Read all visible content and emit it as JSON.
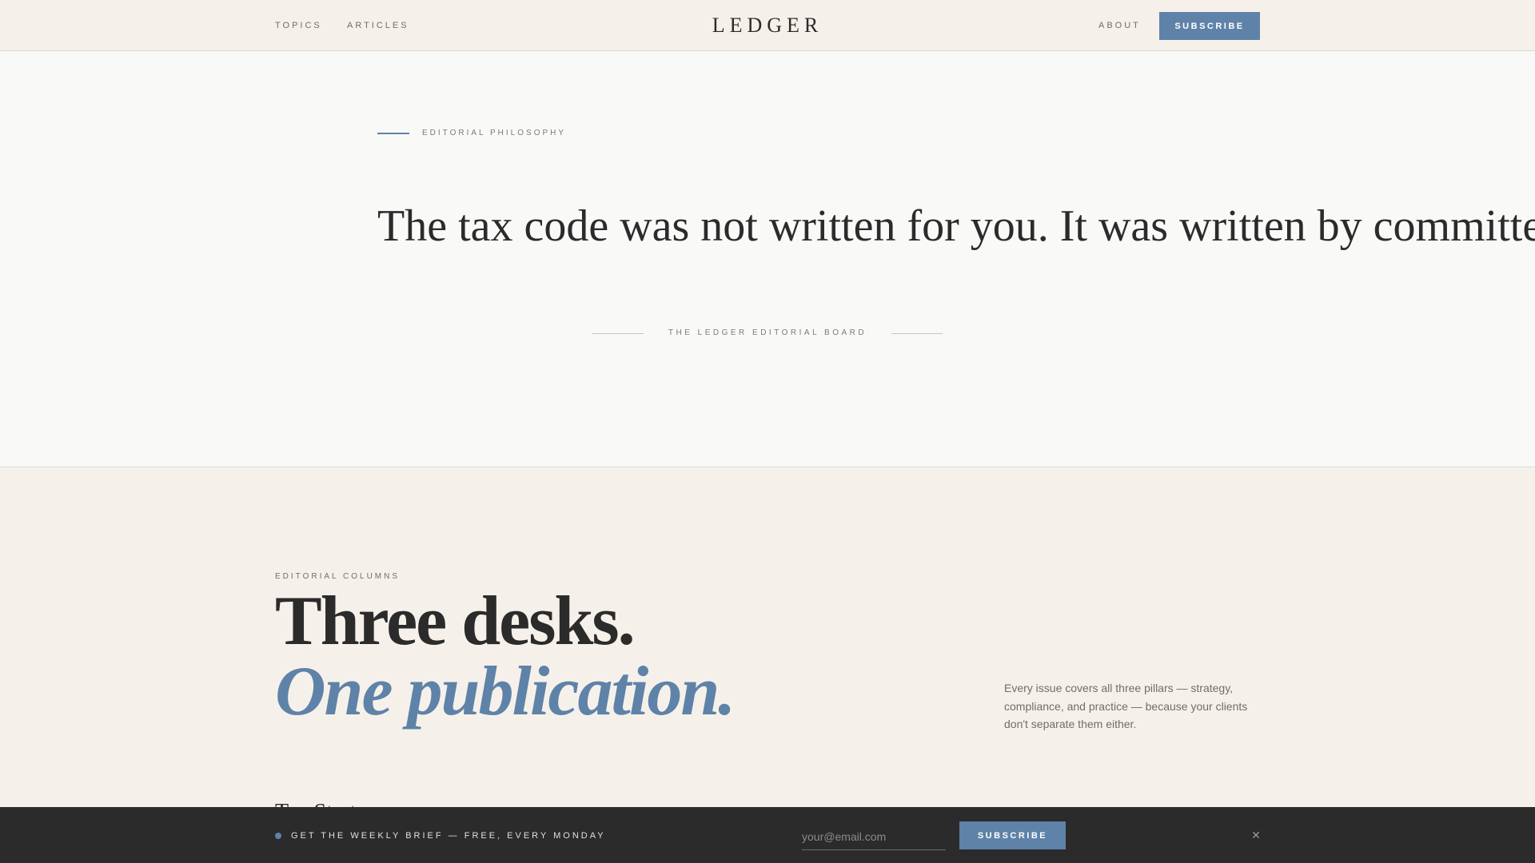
{
  "header": {
    "nav_left": [
      "TOPICS",
      "ARTICLES"
    ],
    "logo": "LEDGER",
    "nav_right": "ABOUT",
    "subscribe_label": "SUBSCRIBE"
  },
  "philosophy": {
    "eyebrow": "EDITORIAL PHILOSOPHY",
    "quote": "The tax code was not written for you. It was written by committees",
    "byline": "THE LEDGER EDITORIAL BOARD"
  },
  "columns": {
    "eyebrow": "EDITORIAL COLUMNS",
    "headline": "Three desks.",
    "headline_italic": "One publication.",
    "description": "Every issue covers all three pillars — strategy, compliance, and practice — because your clients don't separate them either.",
    "first_desk_title": "Tax Strategy"
  },
  "newsletter": {
    "text": "GET THE WEEKLY BRIEF — FREE, EVERY MONDAY",
    "email_placeholder": "your@email.com",
    "subscribe_label": "SUBSCRIBE",
    "close_icon": "close-icon"
  },
  "colors": {
    "accent": "#5f82a8",
    "header_bg": "#f5f1ea",
    "page_bg": "#f9f9f8",
    "text": "#2b2b2b",
    "bar_bg": "#2b2b2b"
  }
}
